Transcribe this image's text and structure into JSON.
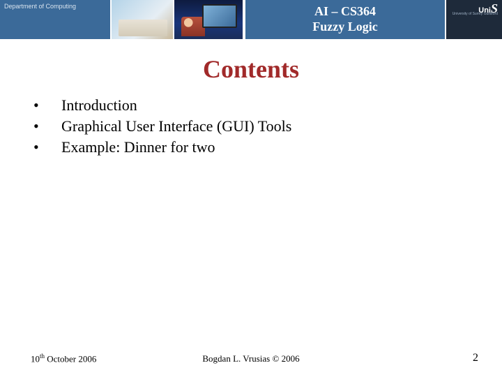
{
  "header": {
    "dept_label": "Department of Computing",
    "title_line1": "AI – CS364",
    "title_line2": "Fuzzy Logic",
    "logo_main": "UniS",
    "logo_sub": "University of Surrey\nGuildford"
  },
  "body": {
    "heading": "Contents",
    "bullets": [
      "Introduction",
      "Graphical User Interface (GUI) Tools",
      "Example: Dinner for two"
    ]
  },
  "footer": {
    "date_day": "10",
    "date_ord": "th",
    "date_rest": " October 2006",
    "author": "Bogdan L. Vrusias © 2006",
    "page": "2"
  }
}
